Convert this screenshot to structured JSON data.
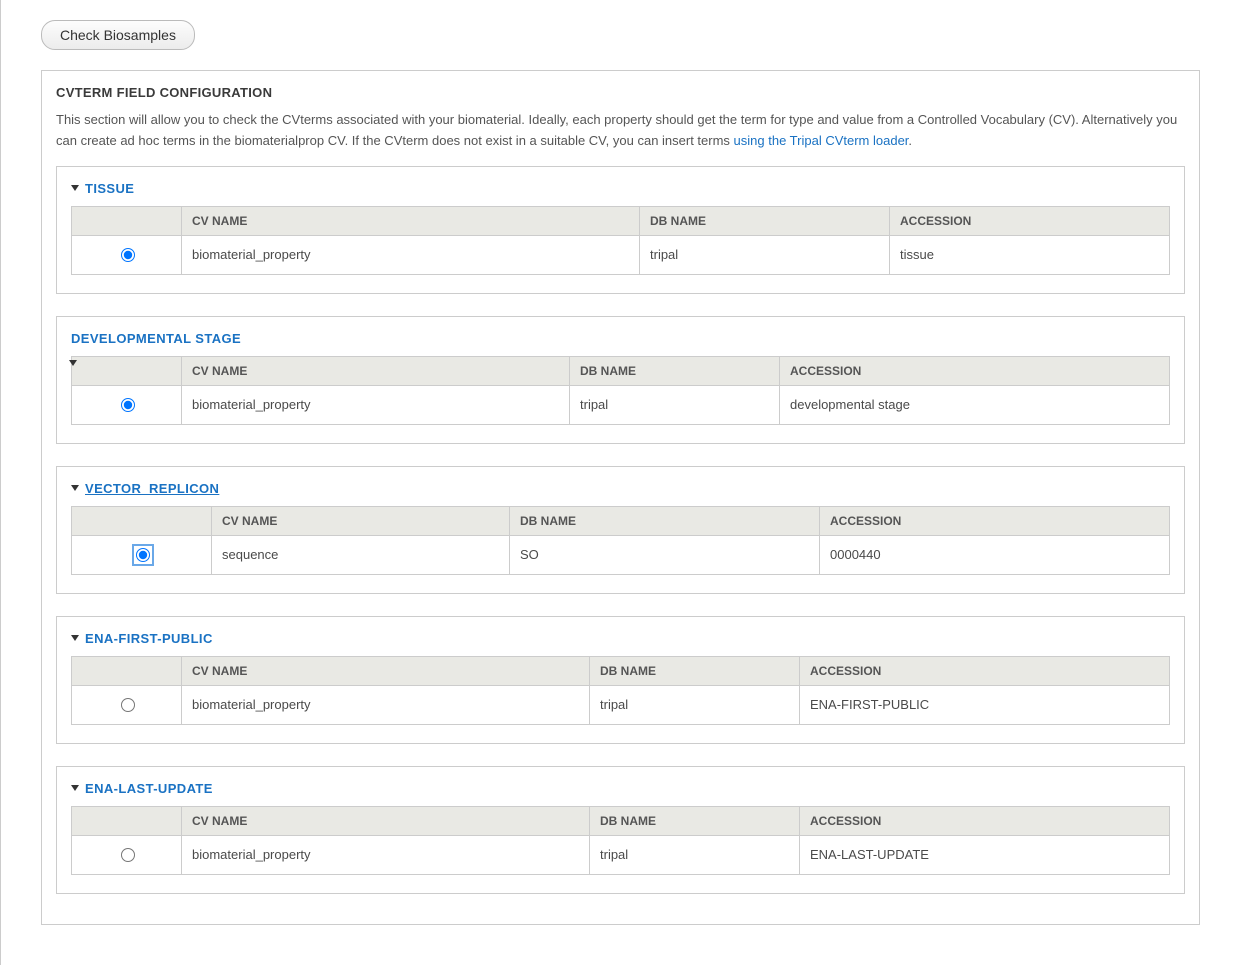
{
  "button_label": "Check Biosamples",
  "panel": {
    "heading": "CVTERM FIELD CONFIGURATION",
    "intro_text": "This section will allow you to check the CVterms associated with your biomaterial. Ideally, each property should get the term for type and value from a Controlled Vocabulary (CV). Alternatively you can create ad hoc terms in the biomaterialprop CV. If the CVterm does not exist in a suitable CV, you can insert terms ",
    "link_text": "using the Tripal CVterm loader",
    "intro_tail": "."
  },
  "columns": {
    "cv": "CV NAME",
    "db": "DB NAME",
    "acc": "ACCESSION"
  },
  "sections": [
    {
      "title": "TISSUE",
      "underline": false,
      "radio_checked": true,
      "radio_focused": false,
      "row": {
        "cv": "biomaterial_property",
        "db": "tripal",
        "acc": "tissue"
      },
      "col_widths": [
        "110px",
        "",
        "250px",
        "280px"
      ]
    },
    {
      "title": "DEVELOPMENTAL STAGE",
      "underline": false,
      "caret_below": true,
      "radio_checked": true,
      "radio_focused": false,
      "row": {
        "cv": "biomaterial_property",
        "db": "tripal",
        "acc": "developmental stage"
      },
      "col_widths": [
        "110px",
        "",
        "210px",
        "390px"
      ]
    },
    {
      "title": "VECTOR_REPLICON",
      "underline": true,
      "radio_checked": true,
      "radio_focused": true,
      "row": {
        "cv": "sequence",
        "db": "SO",
        "acc": "0000440"
      },
      "col_widths": [
        "140px",
        "",
        "310px",
        "350px"
      ]
    },
    {
      "title": "ENA-FIRST-PUBLIC",
      "underline": false,
      "radio_checked": false,
      "radio_focused": false,
      "row": {
        "cv": "biomaterial_property",
        "db": "tripal",
        "acc": "ENA-FIRST-PUBLIC"
      },
      "col_widths": [
        "110px",
        "",
        "210px",
        "370px"
      ]
    },
    {
      "title": "ENA-LAST-UPDATE",
      "underline": false,
      "radio_checked": false,
      "radio_focused": false,
      "row": {
        "cv": "biomaterial_property",
        "db": "tripal",
        "acc": "ENA-LAST-UPDATE"
      },
      "col_widths": [
        "110px",
        "",
        "210px",
        "370px"
      ]
    }
  ]
}
